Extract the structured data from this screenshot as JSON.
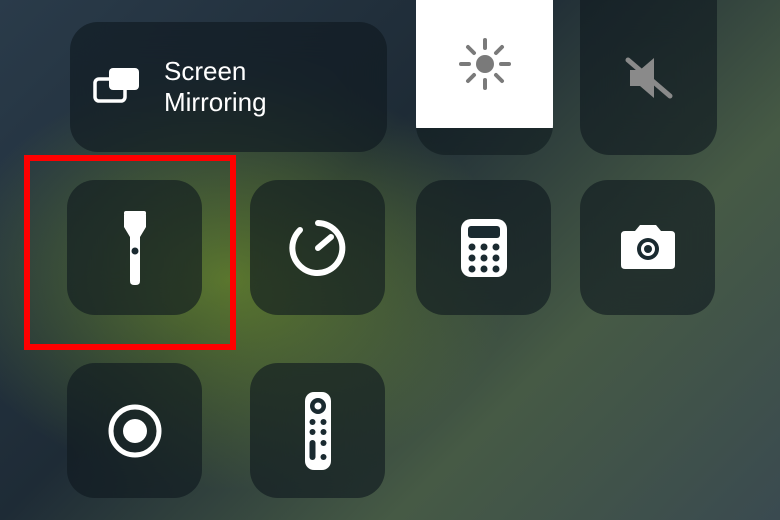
{
  "screenMirroring": {
    "label": "Screen\nMirroring"
  },
  "brightness": {
    "level_percent": 82
  },
  "volume": {
    "muted": true
  },
  "tiles": {
    "flashlight": {
      "name": "Flashlight",
      "highlighted": true
    },
    "timer": {
      "name": "Timer"
    },
    "calculator": {
      "name": "Calculator"
    },
    "camera": {
      "name": "Camera"
    },
    "screenRecord": {
      "name": "Screen Recording"
    },
    "remote": {
      "name": "Apple TV Remote"
    }
  },
  "annotation": {
    "highlight_color": "#ff0000"
  }
}
